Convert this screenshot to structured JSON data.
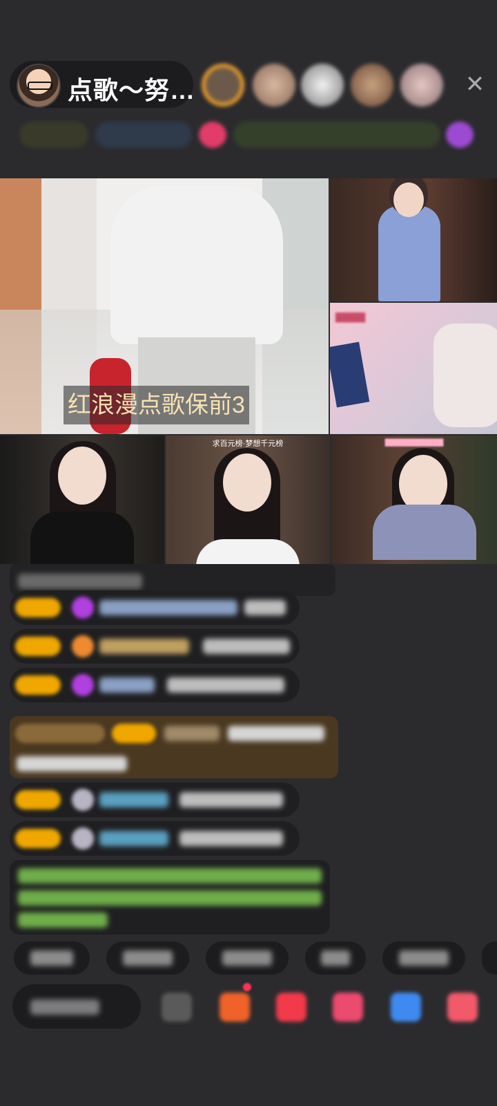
{
  "header": {
    "host_title": "点歌～努…",
    "close_icon": "✕"
  },
  "stream": {
    "main_banner": "红浪漫点歌保前3",
    "tile_b2_caption": "求百元榜·梦想千元榜"
  },
  "colors": {
    "background": "#2b2b2e",
    "banner_text": "#f6e2b4",
    "badge_gold": "#f0a800",
    "highlight_row": "#4a3820",
    "announcement_text": "#6fae4a"
  }
}
